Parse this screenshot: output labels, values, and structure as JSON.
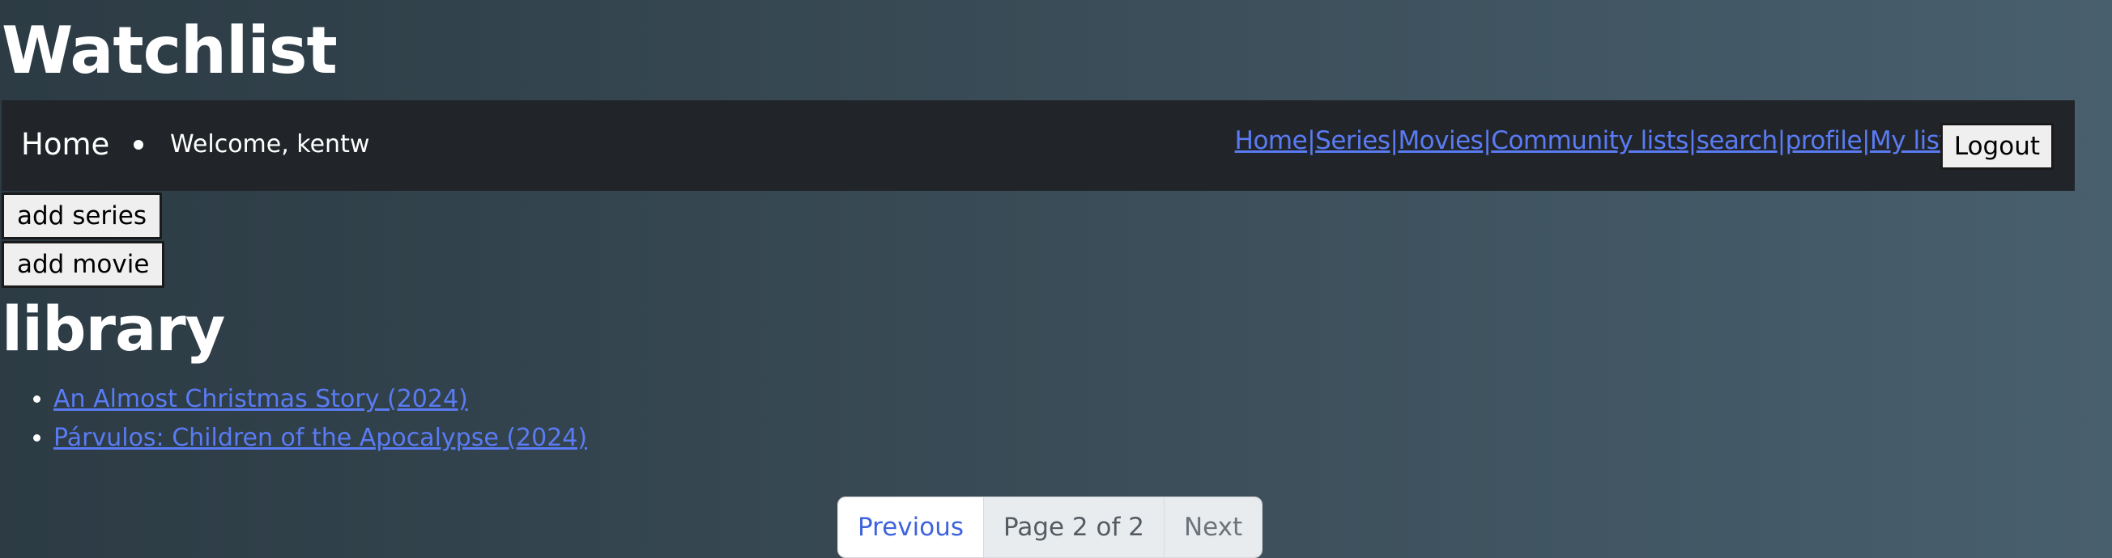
{
  "app": {
    "title": "Watchlist"
  },
  "navbar": {
    "brand": "Home",
    "welcome": "Welcome, kentw",
    "links": [
      "Home",
      "Series",
      "Movies",
      "Community lists",
      "search",
      "profile",
      "My list"
    ],
    "separator": "|",
    "logout_label": "Logout"
  },
  "actions": {
    "add_series_label": "add series",
    "add_movie_label": "add movie"
  },
  "library": {
    "title": "library",
    "items": [
      "An Almost Christmas Story (2024)",
      "Párvulos: Children of the Apocalypse (2024)"
    ]
  },
  "pagination": {
    "previous_label": "Previous",
    "page_info": "Page 2 of 2",
    "next_label": "Next"
  },
  "colors": {
    "link": "#5a7bf3",
    "navbar_bg": "#212529"
  }
}
